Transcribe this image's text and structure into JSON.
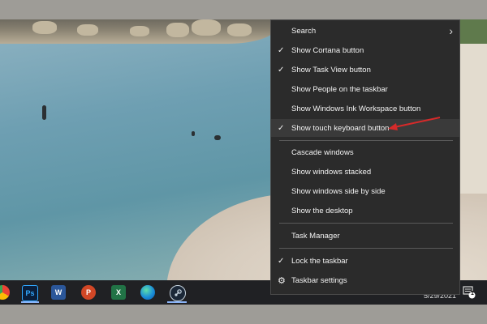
{
  "menu": {
    "items": [
      {
        "label": "Search",
        "checked": false,
        "submenu": true
      },
      {
        "label": "Show Cortana button",
        "checked": true
      },
      {
        "label": "Show Task View button",
        "checked": true
      },
      {
        "label": "Show People on the taskbar",
        "checked": false
      },
      {
        "label": "Show Windows Ink Workspace button",
        "checked": false
      },
      {
        "label": "Show touch keyboard button",
        "checked": true,
        "highlighted": true
      },
      {
        "label": "Cascade windows"
      },
      {
        "label": "Show windows stacked"
      },
      {
        "label": "Show windows side by side"
      },
      {
        "label": "Show the desktop"
      },
      {
        "label": "Task Manager"
      },
      {
        "label": "Lock the taskbar",
        "checked": true
      },
      {
        "label": "Taskbar settings",
        "icon": "gear-icon"
      }
    ],
    "check_glyph": "✓",
    "submenu_glyph": "›",
    "gear_glyph": "⚙"
  },
  "taskbar": {
    "apps": [
      {
        "name": "chrome-icon",
        "text": ""
      },
      {
        "name": "photoshop-icon",
        "text": "Ps"
      },
      {
        "name": "word-icon",
        "text": "W"
      },
      {
        "name": "powerpoint-icon",
        "text": "P"
      },
      {
        "name": "excel-icon",
        "text": "X"
      },
      {
        "name": "edge-icon",
        "text": ""
      },
      {
        "name": "steam-icon",
        "text": ""
      }
    ],
    "date": "5/29/2021",
    "notification_count": "1"
  },
  "colors": {
    "menu_bg": "#2b2b2b",
    "highlight_bg": "#3a3a3a",
    "annotation_arrow": "#d62a2a"
  }
}
